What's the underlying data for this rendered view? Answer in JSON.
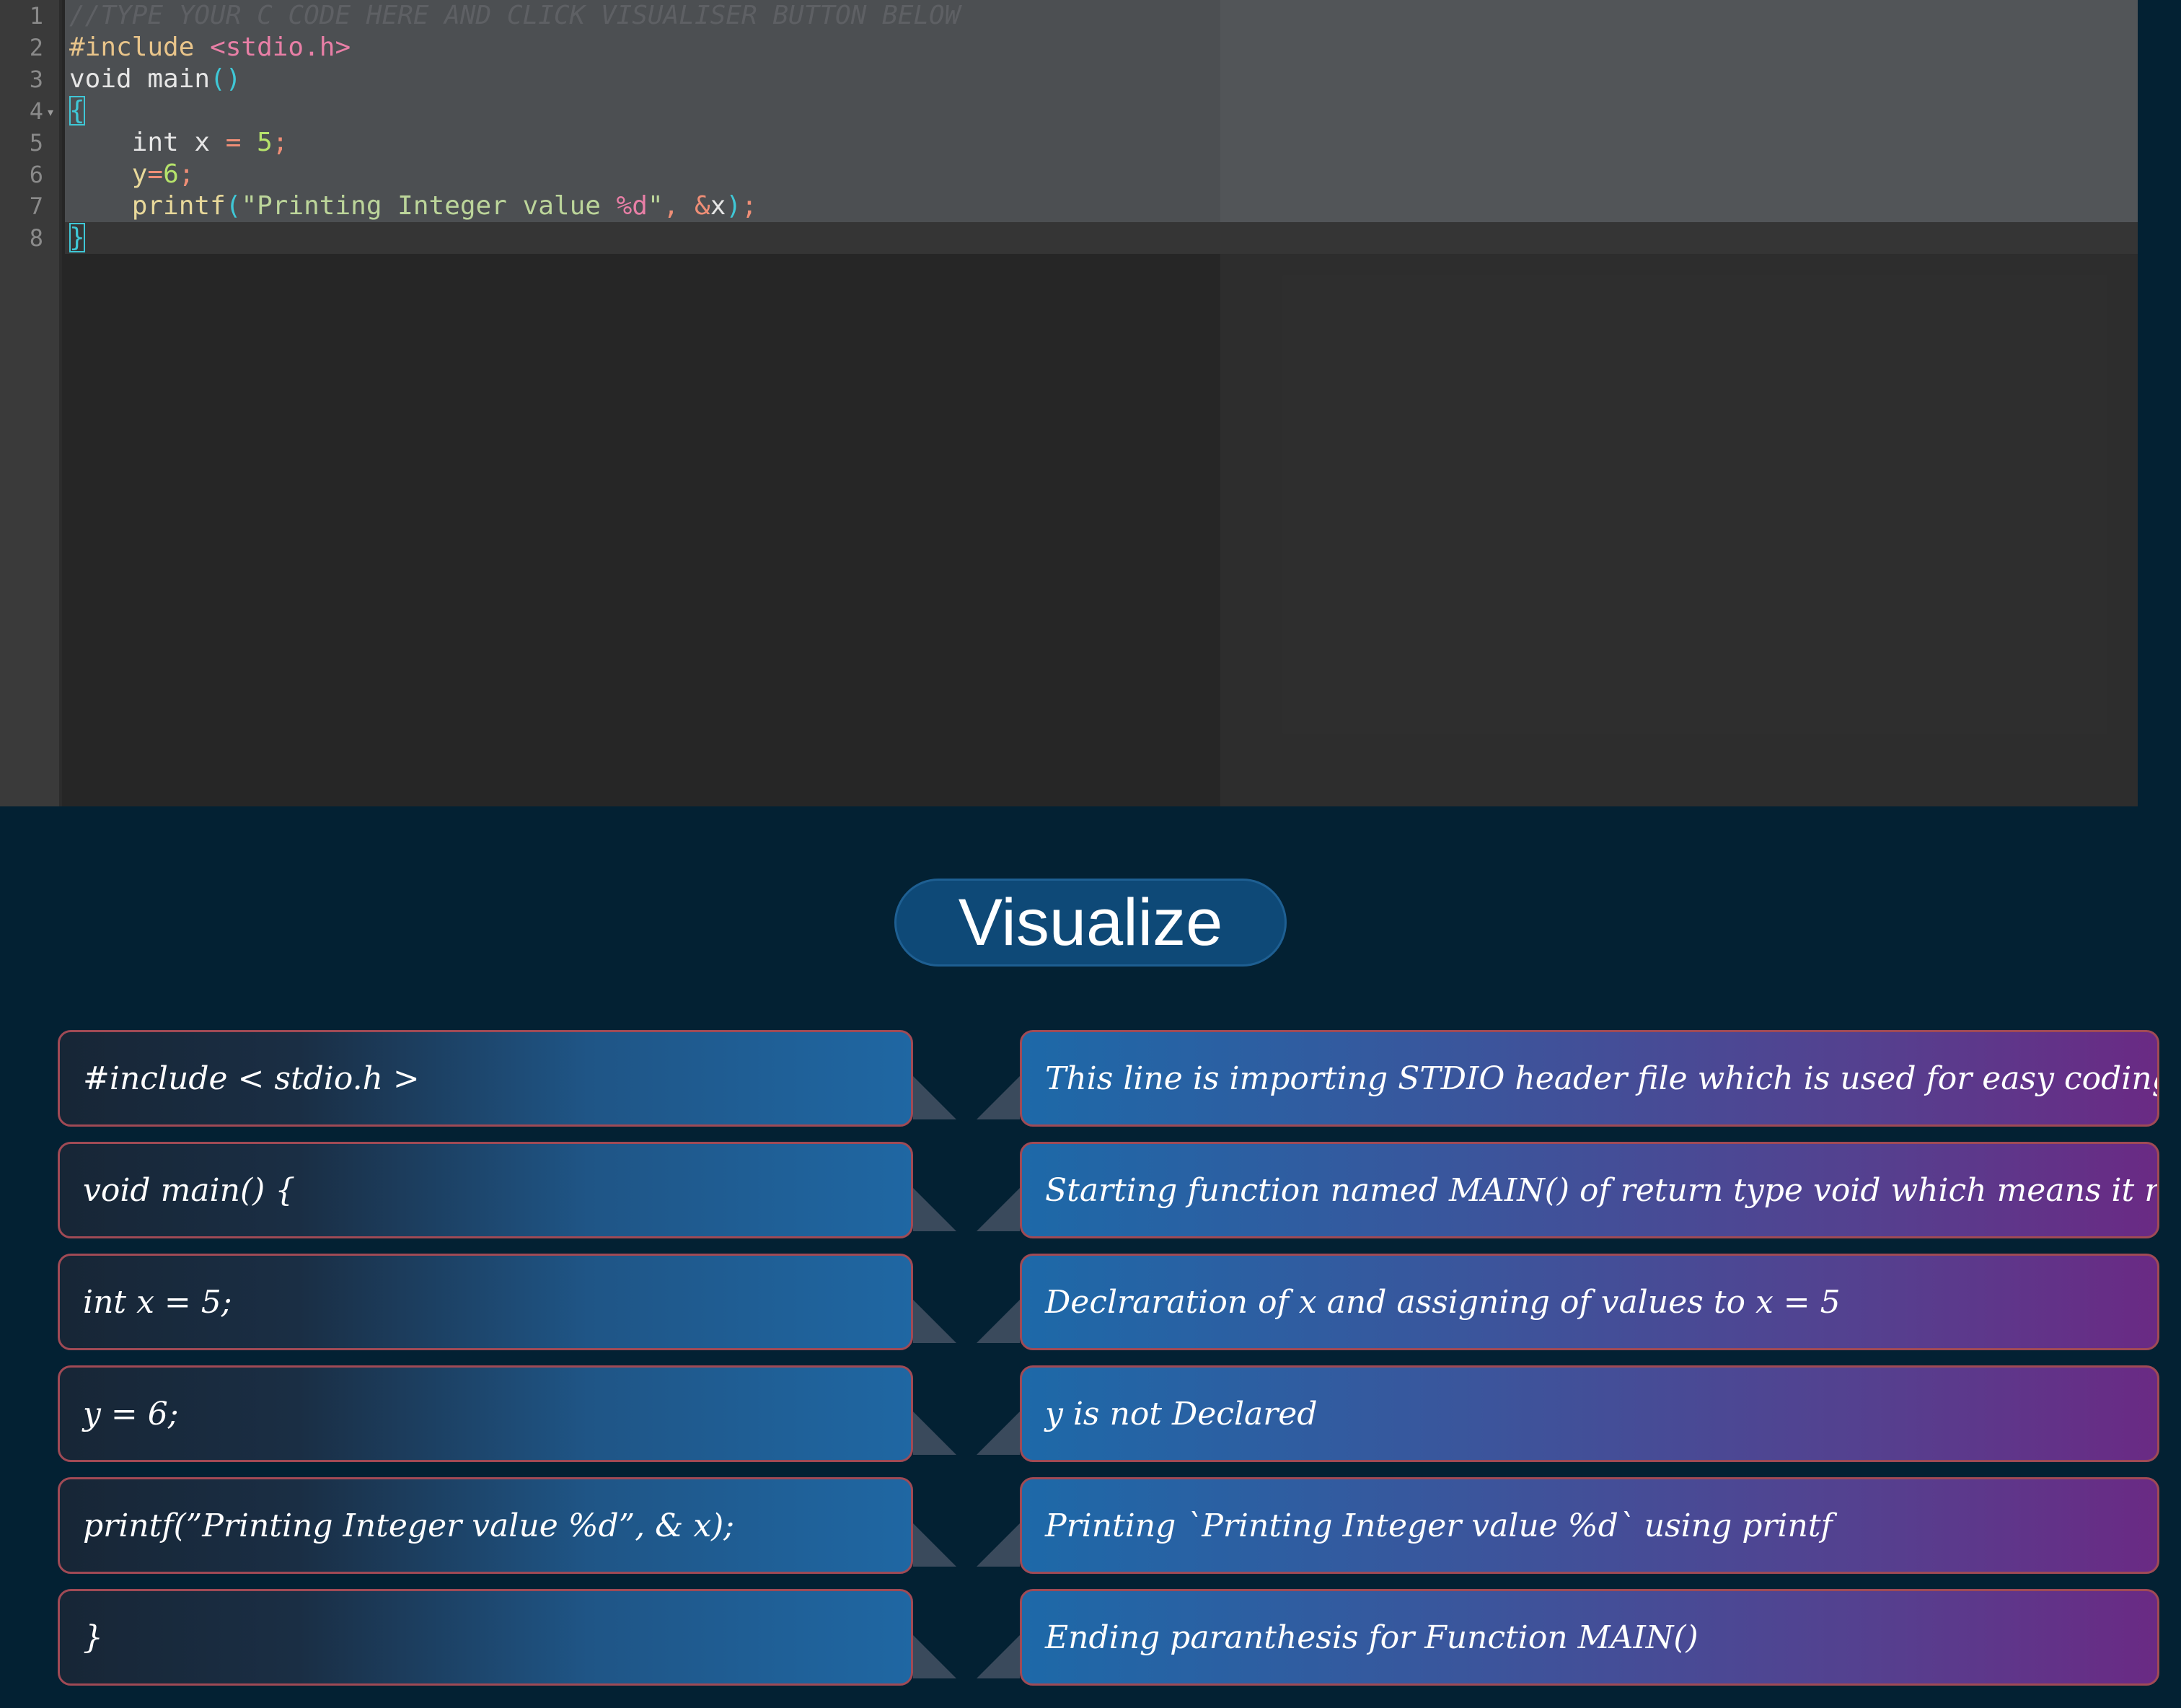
{
  "editor": {
    "line_numbers": [
      "1",
      "2",
      "3",
      "4",
      "5",
      "6",
      "7",
      "8"
    ],
    "fold_marker": "▾",
    "lines": {
      "comment": "//TYPE YOUR C CODE HERE AND CLICK VISUALISER BUTTON BELOW",
      "include_kw": "#include",
      "include_hdr": " <stdio.h>",
      "void_main": "void main",
      "parens": "()",
      "open_brace": "{",
      "int_indent": "    int x ",
      "eq": "=",
      "five": " 5",
      "semi": ";",
      "y_indent": "    y",
      "six": "6",
      "printf_indent": "    printf",
      "open_paren": "(",
      "str_a": "\"Printing Integer value ",
      "fmt": "%d",
      "str_b": "\"",
      "comma": ", ",
      "amp": "&",
      "x": "x",
      "close_paren": ")",
      "close_brace": "}"
    }
  },
  "visualize_button": {
    "label": "Visualize"
  },
  "rows": [
    {
      "code": "#include < stdio.h >",
      "description": "This line is importing STDIO header file which is used for easy coding"
    },
    {
      "code": "void main() {",
      "description": "Starting function named MAIN() of return type void which means it returns nothing"
    },
    {
      "code": "int x = 5;",
      "description": "Declraration of x and assigning of values to x = 5"
    },
    {
      "code": "y = 6;",
      "description": "y is not Declared"
    },
    {
      "code": "printf(”Printing Integer value %d”, & x);",
      "description": "Printing `Printing Integer value %d` using printf"
    },
    {
      "code": "}",
      "description": "Ending paranthesis for Function MAIN()"
    }
  ],
  "colors": {
    "page_bg": "#032133",
    "editor_bg": "#262626",
    "button_bg": "#0e4977",
    "card_border": "#a04a55"
  }
}
